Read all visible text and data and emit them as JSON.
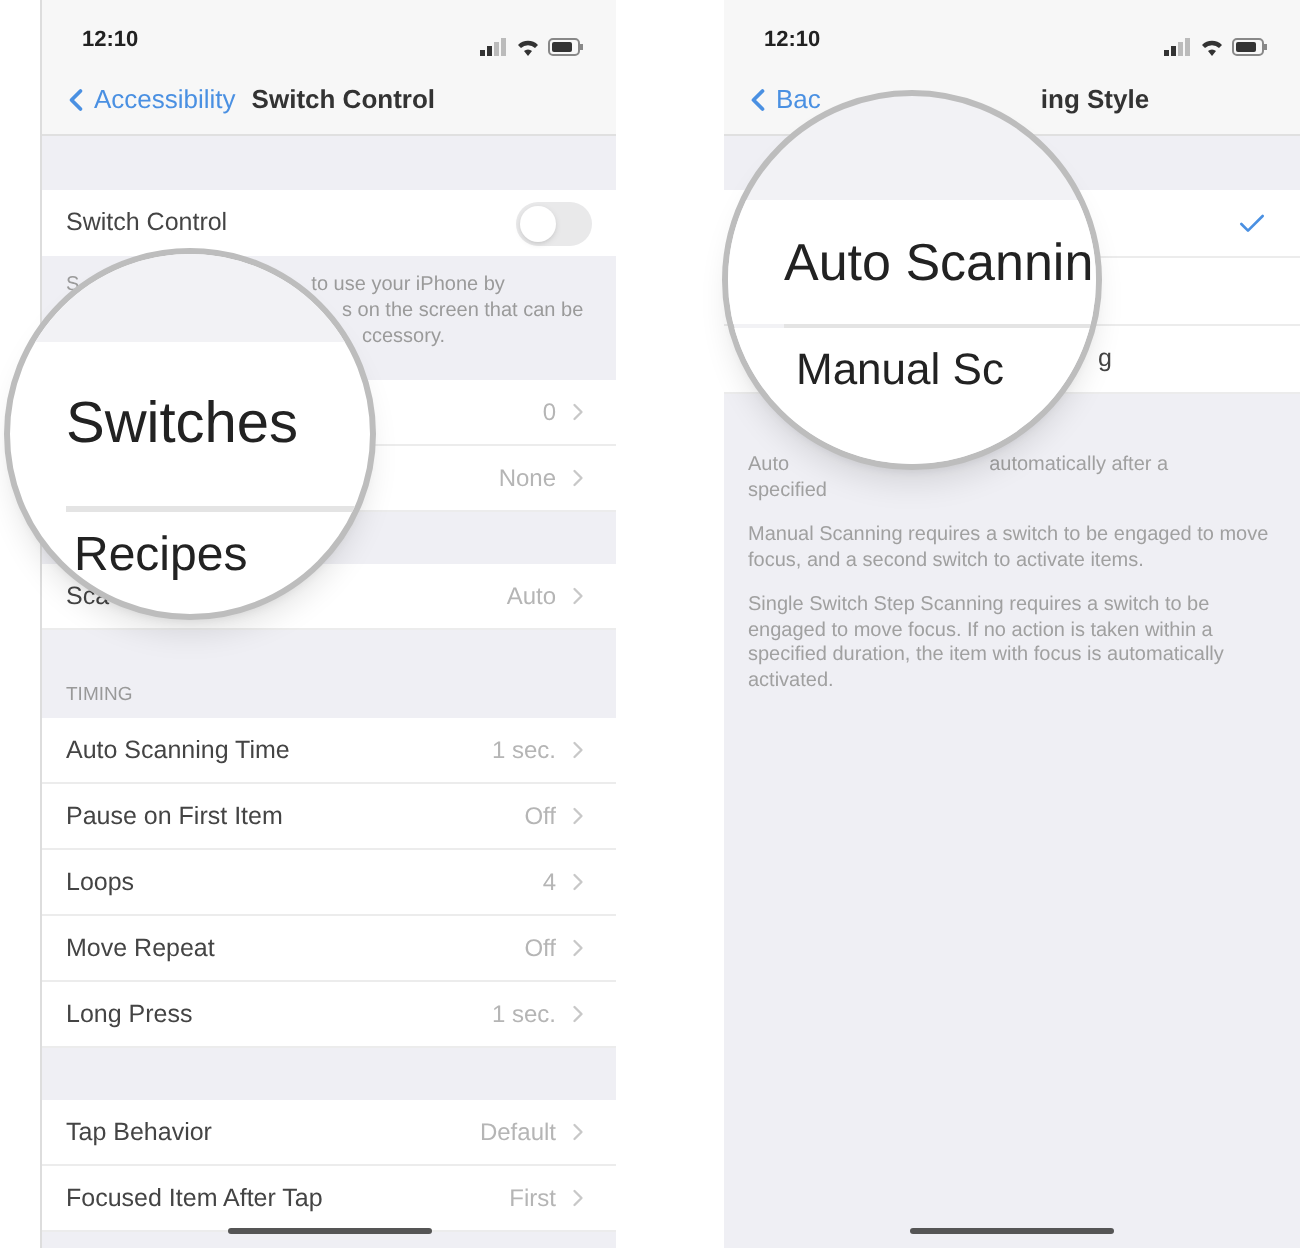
{
  "left_screen": {
    "status_bar": {
      "time": "12:10"
    },
    "nav": {
      "back": "Accessibility",
      "title": "Switch Control"
    },
    "toggle_row": {
      "label": "Switch Control",
      "on": false
    },
    "description_lines": [
      [
        "S",
        "to use your iPhone by"
      ],
      [
        "s on the screen that can be"
      ],
      [
        "ccessory."
      ]
    ],
    "groups": [
      {
        "rows": [
          {
            "value": "0"
          },
          {
            "value": "None"
          }
        ]
      },
      {
        "rows": [
          {
            "label": "Sca",
            "value": "Auto"
          }
        ]
      },
      {
        "header": "TIMING",
        "rows": [
          {
            "label": "Auto Scanning Time",
            "value": "1 sec."
          },
          {
            "label": "Pause on First Item",
            "value": "Off"
          },
          {
            "label": "Loops",
            "value": "4"
          },
          {
            "label": "Move Repeat",
            "value": "Off"
          },
          {
            "label": "Long Press",
            "value": "1 sec."
          }
        ]
      },
      {
        "rows": [
          {
            "label": "Tap Behavior",
            "value": "Default"
          },
          {
            "label": "Focused Item After Tap",
            "value": "First"
          }
        ]
      }
    ],
    "magnifier": {
      "texts": [
        "Switches",
        "Recipes"
      ]
    }
  },
  "right_screen": {
    "status_bar": {
      "time": "12:10"
    },
    "nav": {
      "back": "Bac",
      "title": "ing Style"
    },
    "options": [
      {
        "selected": true
      },
      {
        "selected": false
      },
      {
        "label": "g",
        "selected": false
      }
    ],
    "footer_lines": [
      [
        "Auto",
        "automatically after a"
      ],
      [
        "specified"
      ]
    ],
    "footer_paragraphs": [
      "Manual Scanning requires a switch to be engaged to move focus, and a second switch to activate items.",
      "Single Switch Step Scanning requires a switch to be engaged to move focus. If no action is taken within a specified duration, the item with focus is automatically activated."
    ],
    "magnifier": {
      "texts": [
        "Auto Scannin",
        "Manual Sc"
      ]
    }
  }
}
